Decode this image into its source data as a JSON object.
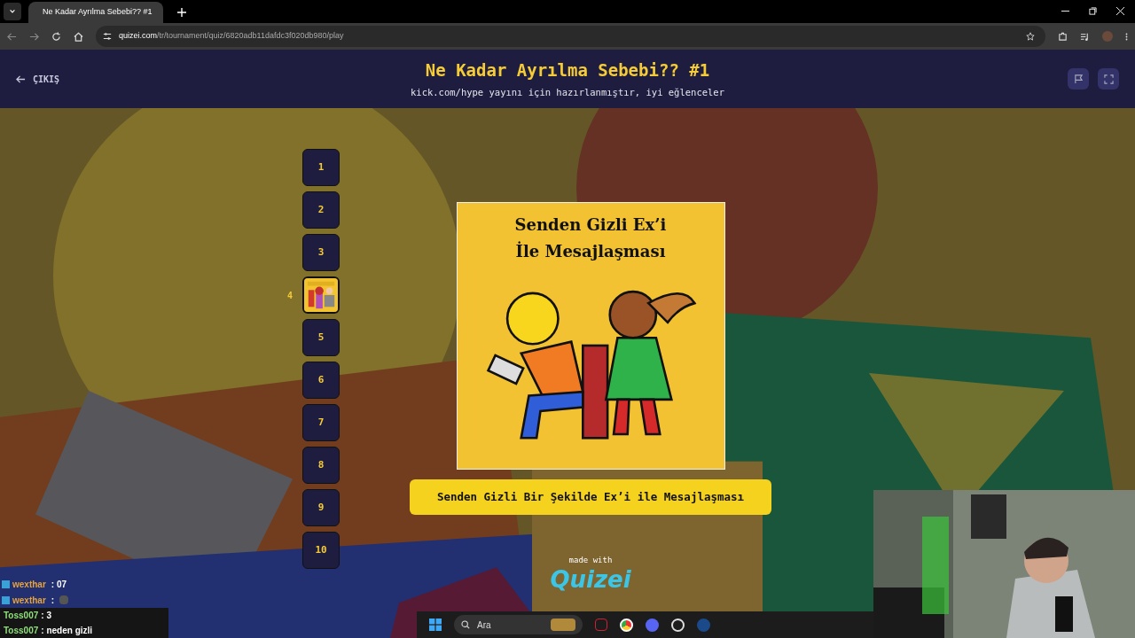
{
  "browser": {
    "tab_title": "Ne Kadar Ayrılma Sebebi?? #1",
    "url_host": "quizei.com",
    "url_path": "/tr/tournament/quiz/6820adb11dafdc3f020db980/play"
  },
  "header": {
    "back_label": "ÇIKIŞ",
    "title": "Ne Kadar Ayrılma Sebebi?? #1",
    "subtitle": "kick.com/hype yayını için hazırlanmıştır, iyi eğlenceler"
  },
  "ranks": [
    {
      "label": "1",
      "selected": false
    },
    {
      "label": "2",
      "selected": false
    },
    {
      "label": "3",
      "selected": false
    },
    {
      "label": "4",
      "selected": true
    },
    {
      "label": "5",
      "selected": false
    },
    {
      "label": "6",
      "selected": false
    },
    {
      "label": "7",
      "selected": false
    },
    {
      "label": "8",
      "selected": false
    },
    {
      "label": "9",
      "selected": false
    },
    {
      "label": "10",
      "selected": false
    }
  ],
  "card": {
    "title": "Senden Gizli Ex’i İle Mesajlaşması",
    "answer": "Senden Gizli Bir Şekilde Ex’i ile Mesajlaşması"
  },
  "footer": {
    "made_with": "made with",
    "logo": "Quizei"
  },
  "chat": [
    {
      "user": "wexthar",
      "text": ": 07",
      "color": "#e8a33a"
    },
    {
      "user": "wexthar",
      "text": ":",
      "color": "#e8a33a"
    },
    {
      "user": "Toss007",
      "text": ": 3",
      "color": "#8fe07a"
    },
    {
      "user": "Toss007",
      "text": ": neden gizli",
      "color": "#8fe07a"
    }
  ],
  "taskbar": {
    "search_placeholder": "Ara"
  }
}
